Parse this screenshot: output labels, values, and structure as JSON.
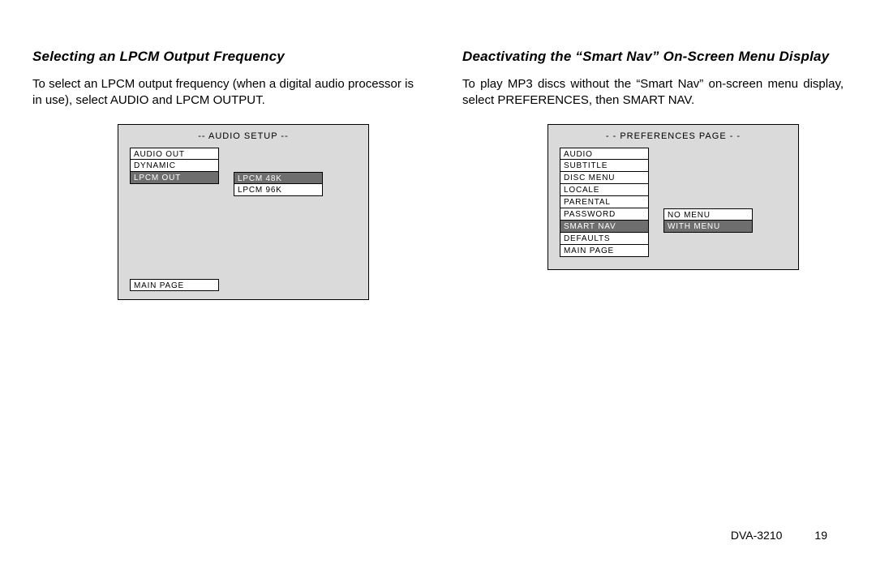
{
  "left": {
    "heading": "Selecting an LPCM Output Frequency",
    "para": "To select an LPCM output frequency (when a digital audio processor is in use), select AUDIO and LPCM OUTPUT.",
    "osd": {
      "title": "-- AUDIO SETUP --",
      "items": [
        "AUDIO OUT",
        "DYNAMIC",
        "LPCM OUT"
      ],
      "selectedIndex": 2,
      "sub": [
        "LPCM 48K",
        "LPCM 96K"
      ],
      "subSelectedIndex": 0,
      "footer": "MAIN PAGE"
    }
  },
  "right": {
    "heading": "Deactivating the “Smart Nav” On-Screen Menu Display",
    "para": "To play MP3 discs without the “Smart Nav” on-screen menu display, select PREFERENCES, then SMART NAV.",
    "osd": {
      "title": "- -   PREFERENCES   PAGE   - -",
      "items": [
        "AUDIO",
        "SUBTITLE",
        "DISC MENU",
        "LOCALE",
        "PARENTAL",
        "PASSWORD",
        "SMART NAV",
        "DEFAULTS"
      ],
      "selectedIndex": 6,
      "sub": [
        "NO MENU",
        "WITH MENU"
      ],
      "subSelectedIndex": 1,
      "footer": "MAIN PAGE"
    }
  },
  "footer": {
    "model": "DVA-3210",
    "page": "19"
  }
}
